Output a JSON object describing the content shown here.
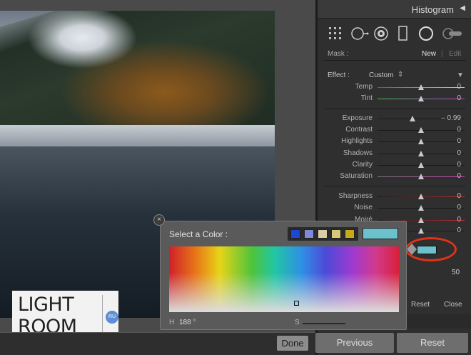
{
  "panel": {
    "title": "Histogram",
    "mask_label": "Mask :",
    "mask_new": "New",
    "mask_edit": "Edit",
    "effect_label": "Effect :",
    "effect_value": "Custom",
    "sliders": [
      {
        "name": "Temp",
        "value": "0",
        "level": 0.5,
        "track": "blue-yellow"
      },
      {
        "name": "Tint",
        "value": "0",
        "level": 0.5,
        "track": "green-magenta"
      },
      {
        "name": "Exposure",
        "value": "– 0.99",
        "level": 0.4,
        "track": "plain"
      },
      {
        "name": "Contrast",
        "value": "0",
        "level": 0.5,
        "track": "plain"
      },
      {
        "name": "Highlights",
        "value": "0",
        "level": 0.5,
        "track": "plain"
      },
      {
        "name": "Shadows",
        "value": "0",
        "level": 0.5,
        "track": "plain"
      },
      {
        "name": "Clarity",
        "value": "0",
        "level": 0.5,
        "track": "plain"
      },
      {
        "name": "Saturation",
        "value": "0",
        "level": 0.5,
        "track": "saturation"
      },
      {
        "name": "Sharpness",
        "value": "0",
        "level": 0.5,
        "track": "red"
      },
      {
        "name": "Noise",
        "value": "0",
        "level": 0.5,
        "track": "plain"
      },
      {
        "name": "Moiré",
        "value": "0",
        "level": 0.5,
        "track": "red"
      },
      {
        "name": "",
        "value": "0",
        "level": 0.5,
        "track": "plain"
      }
    ],
    "amount_value": "50",
    "reset_link": "Reset",
    "close_link": "Close",
    "color_swatch": "#6cc2cc"
  },
  "toolbar": {
    "done_label": "Done",
    "previous_label": "Previous",
    "reset_label": "Reset"
  },
  "logo": {
    "line1": "LIGHT",
    "line2": "ROOM",
    "badge": "RU"
  },
  "color_dialog": {
    "title": "Select a Color :",
    "presets": [
      "#1f47d6",
      "#7c8ad8",
      "#d8cfa6",
      "#d8c87a",
      "#c9a81a"
    ],
    "current_color": "#6cc2cc",
    "h_label": "H",
    "h_value": "188",
    "h_unit": "°",
    "s_label": "S"
  },
  "accent_color": "#e0321a"
}
